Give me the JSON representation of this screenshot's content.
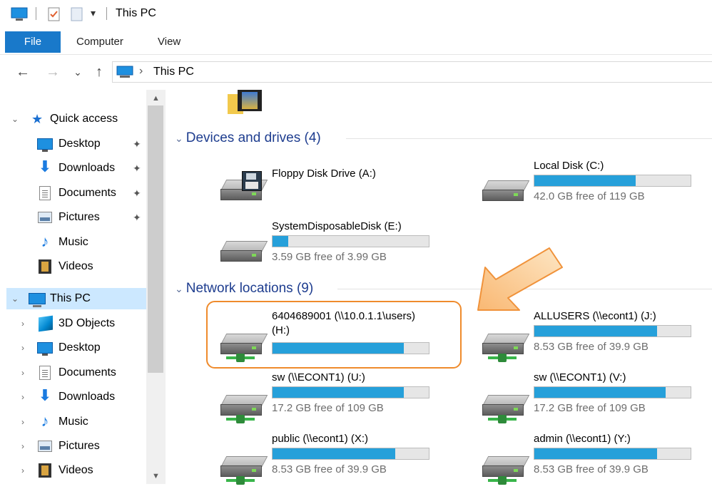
{
  "title_bar": {
    "title": "This PC",
    "icons": [
      "computer-icon",
      "properties-icon",
      "new-folder-icon",
      "customize-quick-access-icon"
    ],
    "dropdown_glyph": "▾"
  },
  "ribbon": {
    "tabs": [
      "File",
      "Computer",
      "View"
    ],
    "accent": "#1979ca"
  },
  "nav": {
    "back": "←",
    "forward": "→",
    "recent": "⌄",
    "up": "↑",
    "breadcrumb_sep": "›",
    "address": "This PC"
  },
  "sidebar": {
    "quick_access": {
      "label": "Quick access",
      "items": [
        {
          "label": "Desktop",
          "icon": "desktop-icon",
          "pinned": true
        },
        {
          "label": "Downloads",
          "icon": "download-icon",
          "pinned": true
        },
        {
          "label": "Documents",
          "icon": "documents-icon",
          "pinned": true
        },
        {
          "label": "Pictures",
          "icon": "pictures-icon",
          "pinned": true
        },
        {
          "label": "Music",
          "icon": "music-icon",
          "pinned": false
        },
        {
          "label": "Videos",
          "icon": "videos-icon",
          "pinned": false
        }
      ]
    },
    "this_pc": {
      "label": "This PC",
      "items": [
        {
          "label": "3D Objects",
          "icon": "3d-objects-icon"
        },
        {
          "label": "Desktop",
          "icon": "desktop-icon"
        },
        {
          "label": "Documents",
          "icon": "documents-icon"
        },
        {
          "label": "Downloads",
          "icon": "download-icon"
        },
        {
          "label": "Music",
          "icon": "music-icon"
        },
        {
          "label": "Pictures",
          "icon": "pictures-icon"
        },
        {
          "label": "Videos",
          "icon": "videos-icon"
        }
      ]
    },
    "pin_glyph": "📌",
    "expand_glyph": "›",
    "expanded_glyph": "⌄"
  },
  "content": {
    "devices": {
      "header": "Devices and drives (4)",
      "drives": [
        {
          "name": "Floppy Disk Drive (A:)",
          "type": "floppy",
          "fill": null,
          "free": ""
        },
        {
          "name": "Local Disk (C:)",
          "type": "hdd",
          "fill": 0.647,
          "free": "42.0 GB free of 119 GB"
        },
        {
          "name": "SystemDisposableDisk (E:)",
          "type": "hdd",
          "fill": 0.1,
          "free": "3.59 GB free of 3.99 GB"
        }
      ]
    },
    "network": {
      "header": "Network locations (9)",
      "drives": [
        {
          "name": "6404689001 (\\\\10.0.1.1\\users)",
          "name2": "(H:)",
          "fill": 0.84,
          "free": ""
        },
        {
          "name": "ALLUSERS (\\\\econt1) (J:)",
          "fill": 0.786,
          "free": "8.53 GB free of 39.9 GB"
        },
        {
          "name": "sw (\\\\ECONT1) (U:)",
          "fill": 0.842,
          "free": "17.2 GB free of 109 GB"
        },
        {
          "name": "sw (\\\\ECONT1) (V:)",
          "fill": 0.842,
          "free": "17.2 GB free of 109 GB"
        },
        {
          "name": "public (\\\\econt1) (X:)",
          "fill": 0.786,
          "free": "8.53 GB free of 39.9 GB"
        },
        {
          "name": "admin (\\\\econt1) (Y:)",
          "fill": 0.786,
          "free": "8.53 GB free of 39.9 GB"
        }
      ]
    },
    "bar_color": "#26a0da",
    "highlight_color": "#ef8b2c"
  }
}
